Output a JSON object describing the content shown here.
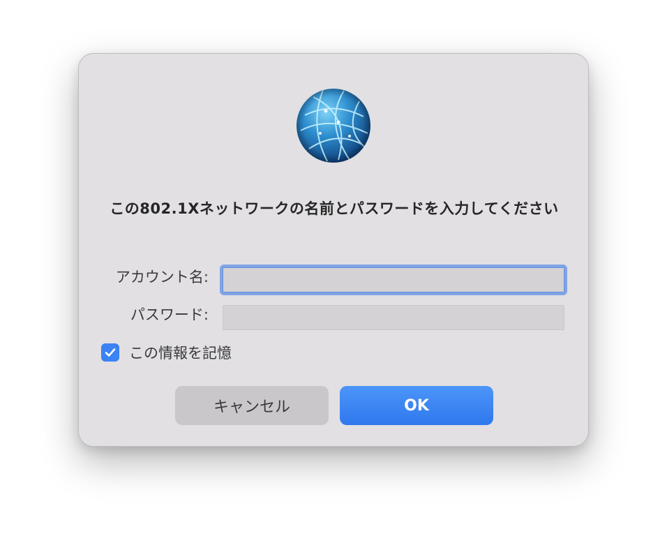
{
  "dialog": {
    "icon": "network-globe-icon",
    "title": "この802.1Xネットワークの名前とパスワードを入力してください",
    "account_label": "アカウント名:",
    "account_value": "",
    "password_label": "パスワード:",
    "password_value": "",
    "remember_label": "この情報を記憶",
    "remember_checked": true,
    "cancel_label": "キャンセル",
    "ok_label": "OK"
  },
  "colors": {
    "dialog_bg": "#e2e0e3",
    "accent": "#3b82f2",
    "focus_ring": "#7fa3e6",
    "cancel_bg": "#c9c7ca"
  }
}
